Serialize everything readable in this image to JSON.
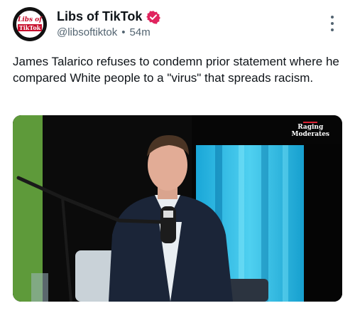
{
  "author": {
    "display_name": "Libs of TikTok",
    "handle": "@libsoftiktok",
    "separator": "•",
    "timestamp": "54m",
    "avatar_text_top": "Libs of",
    "avatar_text_bottom": "TikTok"
  },
  "post": {
    "text": "James Talarico refuses to condemn prior statement where he compared White people to a \"virus\" that spreads racism."
  },
  "media": {
    "watermark_line1": "Raging",
    "watermark_line2": "Moderates"
  },
  "icons": {
    "verified": "verified-badge-icon",
    "more": "more-options-icon"
  },
  "colors": {
    "verified_badge": "#e0245e",
    "secondary_text": "#536471",
    "primary_text": "#0f1419"
  }
}
